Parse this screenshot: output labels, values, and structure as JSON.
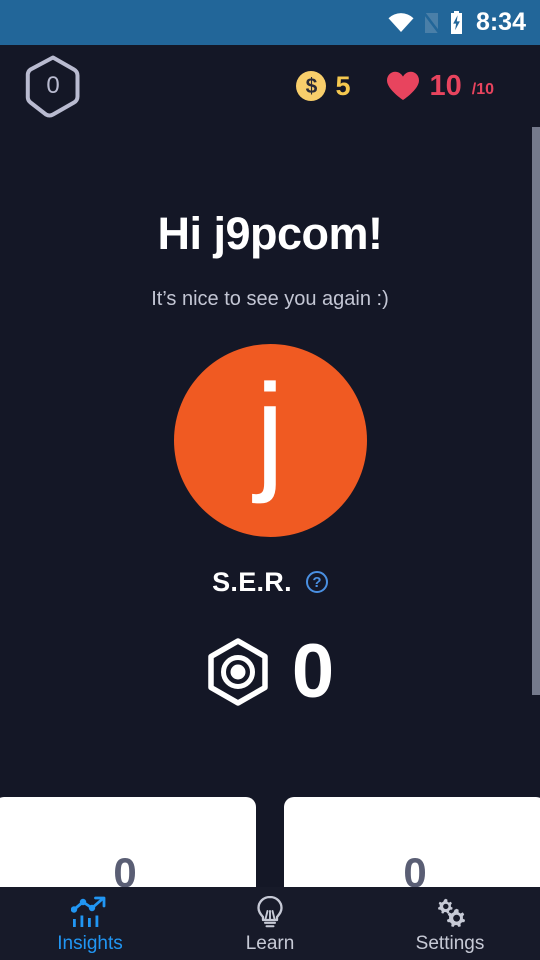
{
  "status_bar": {
    "time": "8:34",
    "icons": [
      "wifi-icon",
      "mobile-signal-off-icon",
      "battery-charging-icon"
    ],
    "background_color": "#226699"
  },
  "header": {
    "level_badge": {
      "icon": "hexagon-outline-icon",
      "value": "0"
    },
    "coins": {
      "icon": "dollar-coin-icon",
      "symbol": "$",
      "value": "5",
      "color": "#f5c84f"
    },
    "lives": {
      "icon": "heart-icon",
      "value": "10",
      "max": "/10",
      "color": "#e8445e"
    }
  },
  "main": {
    "greeting": "Hi j9pcom!",
    "subgreeting": "It’s nice to see you again :)",
    "avatar": {
      "initial": "j",
      "background_color": "#f05a22"
    },
    "ser": {
      "label": "S.E.R.",
      "help_icon": "question-mark-circle-icon",
      "nut_icon": "hex-nut-icon",
      "value": "0"
    },
    "cards": [
      {
        "value": "0"
      },
      {
        "value": "0"
      }
    ]
  },
  "bottom_nav": {
    "items": [
      {
        "label": "Insights",
        "icon": "chart-trend-up-icon",
        "active": true
      },
      {
        "label": "Learn",
        "icon": "lightbulb-icon",
        "active": false
      },
      {
        "label": "Settings",
        "icon": "gears-icon",
        "active": false
      }
    ],
    "active_color": "#2196f3",
    "inactive_color": "#c7cad6"
  },
  "theme": {
    "background": "#141726",
    "nav_background": "#171a29",
    "card_background": "#ffffff"
  }
}
